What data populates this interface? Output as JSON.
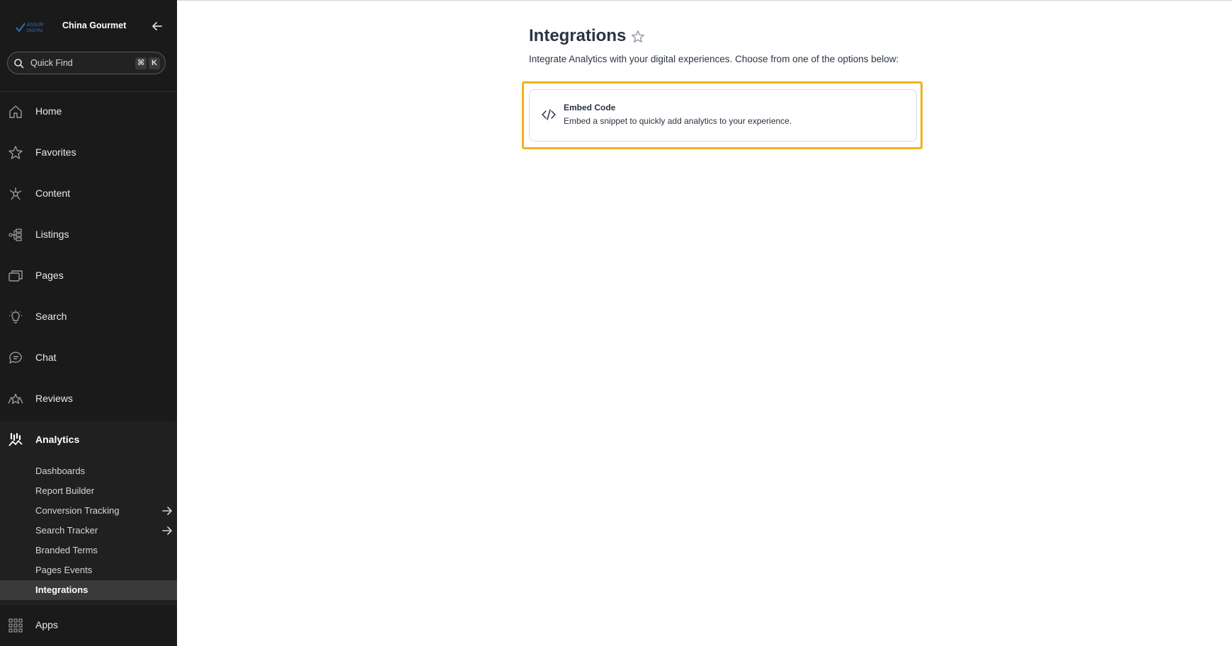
{
  "sidebar": {
    "brand": {
      "name": "China Gourmet",
      "logo_text": "ASSUR DIGITAL"
    },
    "quick_find": {
      "placeholder": "Quick Find",
      "shortcut_cmd": "⌘",
      "shortcut_key": "K"
    },
    "nav": [
      {
        "label": "Home",
        "icon": "home-icon"
      },
      {
        "label": "Favorites",
        "icon": "star-icon"
      },
      {
        "label": "Content",
        "icon": "content-icon"
      },
      {
        "label": "Listings",
        "icon": "listings-icon"
      },
      {
        "label": "Pages",
        "icon": "pages-icon"
      },
      {
        "label": "Search",
        "icon": "lightbulb-icon"
      },
      {
        "label": "Chat",
        "icon": "chat-icon"
      },
      {
        "label": "Reviews",
        "icon": "reviews-icon"
      },
      {
        "label": "Analytics",
        "icon": "analytics-icon",
        "active": true
      },
      {
        "label": "Apps",
        "icon": "apps-grid-icon"
      }
    ],
    "analytics_sub": [
      {
        "label": "Dashboards"
      },
      {
        "label": "Report Builder"
      },
      {
        "label": "Conversion Tracking",
        "has_arrow": true
      },
      {
        "label": "Search Tracker",
        "has_arrow": true
      },
      {
        "label": "Branded Terms"
      },
      {
        "label": "Pages Events"
      },
      {
        "label": "Integrations",
        "active": true
      }
    ]
  },
  "main": {
    "title": "Integrations",
    "description": "Integrate Analytics with your digital experiences. Choose from one of the options below:",
    "options": [
      {
        "title": "Embed Code",
        "description": "Embed a snippet to quickly add analytics to your experience.",
        "icon": "code-icon"
      }
    ]
  },
  "colors": {
    "sidebar_bg": "#1a1a1a",
    "highlight": "#f2b21b",
    "text_dark": "#2b3442"
  }
}
